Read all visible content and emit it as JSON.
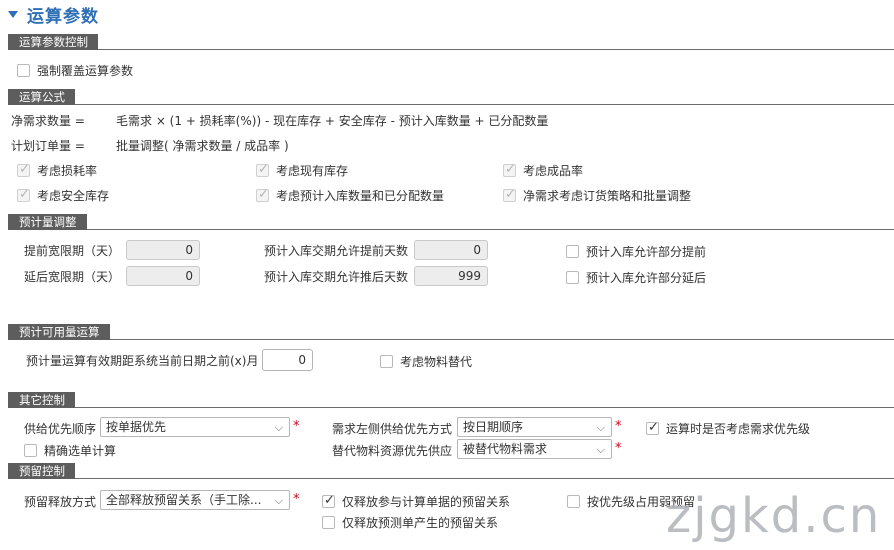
{
  "page_title": "运算参数",
  "sections": {
    "s1": "运算参数控制",
    "s2": "运算公式",
    "s3": "预计量调整",
    "s4": "预计可用量运算",
    "s5": "其它控制",
    "s6": "预留控制"
  },
  "control": {
    "force_override": "强制覆盖运算参数"
  },
  "formula": {
    "net_req_label": "净需求数量 =",
    "net_req_expr": "毛需求 × (1 + 损耗率(%)) - 现在库存 + 安全库存 - 预计入库数量 + 已分配数量",
    "plan_order_label": "计划订单量 =",
    "plan_order_expr": "批量调整( 净需求数量 / 成品率 )",
    "opts": {
      "loss_rate": "考虑损耗率",
      "current_stock": "考虑现有库存",
      "yield_rate": "考虑成品率",
      "safety_stock": "考虑安全库存",
      "incoming_alloc": "考虑预计入库数量和已分配数量",
      "lot_policy": "净需求考虑订货策略和批量调整"
    }
  },
  "adjust": {
    "early_grace_label": "提前宽限期（天）",
    "early_grace_value": "0",
    "late_grace_label": "延后宽限期（天）",
    "late_grace_value": "0",
    "incoming_early_label": "预计入库交期允许提前天数",
    "incoming_early_value": "0",
    "incoming_late_label": "预计入库交期允许推后天数",
    "incoming_late_value": "999",
    "allow_partial_early": "预计入库允许部分提前",
    "allow_partial_late": "预计入库允许部分延后"
  },
  "available": {
    "valid_months_label": "预计量运算有效期距系统当前日期之前(x)月",
    "valid_months_value": "0",
    "consider_substitute": "考虑物料替代"
  },
  "other": {
    "supply_priority_label": "供给优先顺序",
    "supply_priority_value": "按单据优先",
    "demand_left_label": "需求左侧供给优先方式",
    "demand_left_value": "按日期顺序",
    "consider_demand_priority": "运算时是否考虑需求优先级",
    "precise_calc": "精确选单计算",
    "substitute_supply_label": "替代物料资源优先供应",
    "substitute_supply_value": "被替代物料需求"
  },
  "reserve": {
    "release_mode_label": "预留释放方式",
    "release_mode_value": "全部释放预留关系（手工除...",
    "release_only_calc": "仅释放参与计算单据的预留关系",
    "priority_weak": "按优先级占用弱预留",
    "release_forecast": "仅释放预测单产生的预留关系"
  },
  "watermark": "zjgkd.cn",
  "colors": {
    "accent": "#2f6fb6",
    "section_tab": "#5d5d5d",
    "required": "#d9001b"
  }
}
